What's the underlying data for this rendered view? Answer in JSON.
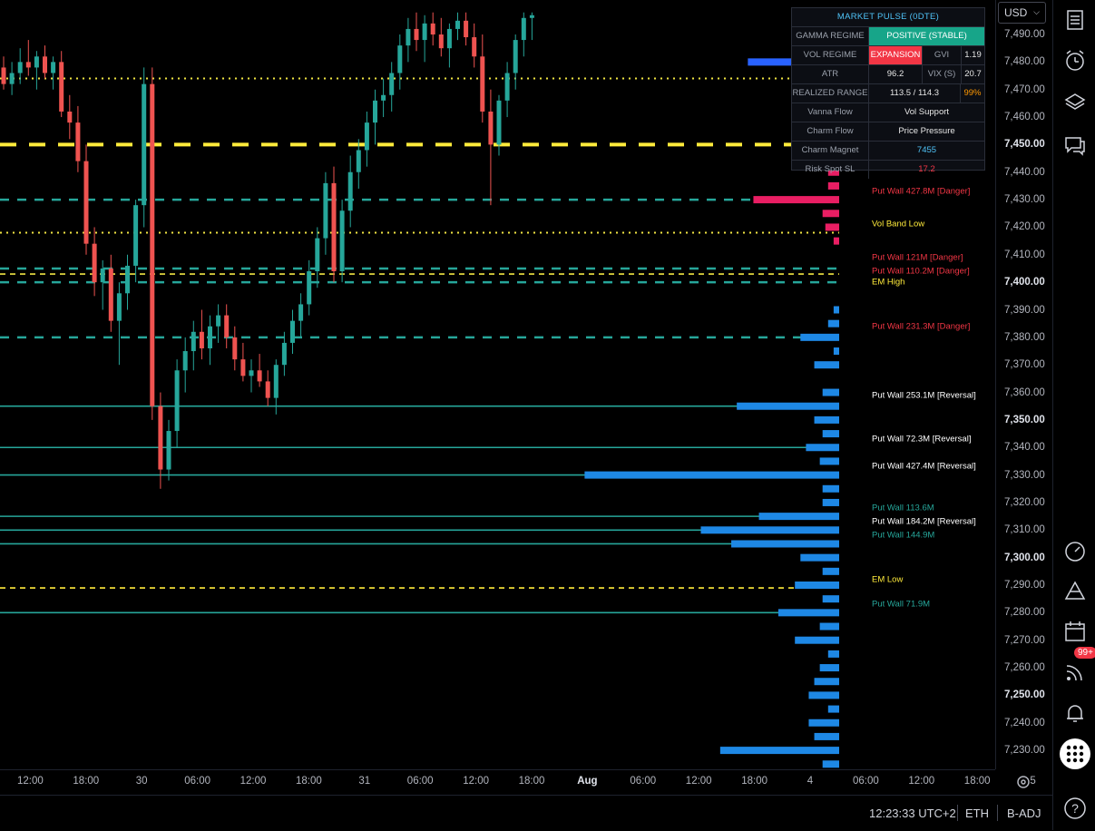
{
  "currency": {
    "label": "USD"
  },
  "price_axis": {
    "ticks": [
      {
        "label": "7,490.00",
        "v": 7490,
        "major": false
      },
      {
        "label": "7,480.00",
        "v": 7480,
        "major": false
      },
      {
        "label": "7,470.00",
        "v": 7470,
        "major": false
      },
      {
        "label": "7,460.00",
        "v": 7460,
        "major": false
      },
      {
        "label": "7,450.00",
        "v": 7450,
        "major": true
      },
      {
        "label": "7,440.00",
        "v": 7440,
        "major": false
      },
      {
        "label": "7,430.00",
        "v": 7430,
        "major": false
      },
      {
        "label": "7,420.00",
        "v": 7420,
        "major": false
      },
      {
        "label": "7,410.00",
        "v": 7410,
        "major": false
      },
      {
        "label": "7,400.00",
        "v": 7400,
        "major": true
      },
      {
        "label": "7,390.00",
        "v": 7390,
        "major": false
      },
      {
        "label": "7,380.00",
        "v": 7380,
        "major": false
      },
      {
        "label": "7,370.00",
        "v": 7370,
        "major": false
      },
      {
        "label": "7,360.00",
        "v": 7360,
        "major": false
      },
      {
        "label": "7,350.00",
        "v": 7350,
        "major": true
      },
      {
        "label": "7,340.00",
        "v": 7340,
        "major": false
      },
      {
        "label": "7,330.00",
        "v": 7330,
        "major": false
      },
      {
        "label": "7,320.00",
        "v": 7320,
        "major": false
      },
      {
        "label": "7,310.00",
        "v": 7310,
        "major": false
      },
      {
        "label": "7,300.00",
        "v": 7300,
        "major": true
      },
      {
        "label": "7,290.00",
        "v": 7290,
        "major": false
      },
      {
        "label": "7,280.00",
        "v": 7280,
        "major": false
      },
      {
        "label": "7,270.00",
        "v": 7270,
        "major": false
      },
      {
        "label": "7,260.00",
        "v": 7260,
        "major": false
      },
      {
        "label": "7,250.00",
        "v": 7250,
        "major": true
      },
      {
        "label": "7,240.00",
        "v": 7240,
        "major": false
      },
      {
        "label": "7,230.00",
        "v": 7230,
        "major": false
      }
    ]
  },
  "time_axis": {
    "ticks": [
      {
        "label": "12:00",
        "t": 1,
        "major": false
      },
      {
        "label": "18:00",
        "t": 2,
        "major": false
      },
      {
        "label": "30",
        "t": 3,
        "major": false
      },
      {
        "label": "06:00",
        "t": 4,
        "major": false
      },
      {
        "label": "12:00",
        "t": 5,
        "major": false
      },
      {
        "label": "18:00",
        "t": 6,
        "major": false
      },
      {
        "label": "31",
        "t": 7,
        "major": false
      },
      {
        "label": "06:00",
        "t": 8,
        "major": false
      },
      {
        "label": "12:00",
        "t": 9,
        "major": false
      },
      {
        "label": "18:00",
        "t": 10,
        "major": false
      },
      {
        "label": "Aug",
        "t": 11,
        "major": true
      },
      {
        "label": "06:00",
        "t": 12,
        "major": false
      },
      {
        "label": "12:00",
        "t": 13,
        "major": false
      },
      {
        "label": "18:00",
        "t": 14,
        "major": false
      },
      {
        "label": "4",
        "t": 15,
        "major": false
      },
      {
        "label": "06:00",
        "t": 16,
        "major": false
      },
      {
        "label": "12:00",
        "t": 17,
        "major": false
      },
      {
        "label": "18:00",
        "t": 18,
        "major": false
      },
      {
        "label": "5",
        "t": 19,
        "major": false
      }
    ]
  },
  "market_pulse": {
    "title": "MARKET PULSE (0DTE)",
    "gamma_regime": {
      "label": "GAMMA REGIME",
      "value": "POSITIVE (STABLE)",
      "color": "#17a589"
    },
    "vol_regime": {
      "label": "VOL REGIME",
      "value": "EXPANSION",
      "value_color": "#f23645",
      "sub_label": "GVI",
      "sub_value": "1.19"
    },
    "atr": {
      "label": "ATR",
      "value": "96.2",
      "sub_label": "VIX (S)",
      "sub_value": "20.7"
    },
    "realized_range": {
      "label": "REALIZED RANGE",
      "value": "113.5 / 114.3",
      "pct": "99%",
      "pct_color": "#ff9800"
    },
    "vanna_flow": {
      "label": "Vanna Flow",
      "value": "Vol Support"
    },
    "charm_flow": {
      "label": "Charm Flow",
      "value": "Price Pressure"
    },
    "charm_magnet": {
      "label": "Charm Magnet",
      "value": "7455",
      "color": "#4fc3f7"
    },
    "risk_spot": {
      "label": "Risk Spot SL",
      "value": "17.2",
      "color": "#f23645"
    }
  },
  "level_lines": [
    {
      "price": 7474,
      "style": "dotted",
      "color": "#f0e442"
    },
    {
      "price": 7450,
      "style": "thickdash",
      "color": "#ffeb3b"
    },
    {
      "price": 7430,
      "style": "dash",
      "color": "#26a69a"
    },
    {
      "price": 7418,
      "style": "dotted",
      "color": "#f0e442"
    },
    {
      "price": 7405,
      "style": "dash",
      "color": "#26a69a"
    },
    {
      "price": 7403,
      "style": "dash2",
      "color": "#f0e442"
    },
    {
      "price": 7400,
      "style": "dash",
      "color": "#26a69a"
    },
    {
      "price": 7380,
      "style": "dash",
      "color": "#26a69a"
    },
    {
      "price": 7355,
      "style": "solid",
      "color": "#26a69a"
    },
    {
      "price": 7340,
      "style": "solid",
      "color": "#26a69a"
    },
    {
      "price": 7330,
      "style": "solid",
      "color": "#26a69a"
    },
    {
      "price": 7315,
      "style": "solid",
      "color": "#26a69a"
    },
    {
      "price": 7310,
      "style": "solid",
      "color": "#26a69a"
    },
    {
      "price": 7305,
      "style": "solid",
      "color": "#26a69a"
    },
    {
      "price": 7289,
      "style": "dash2",
      "color": "#ffeb3b"
    },
    {
      "price": 7280,
      "style": "solid",
      "color": "#26a69a"
    }
  ],
  "wall_labels": [
    {
      "price": 7433,
      "text": "Put Wall 427.8M [Danger]",
      "color": "#f23645"
    },
    {
      "price": 7421,
      "text": "Vol Band Low",
      "color": "#ffeb3b"
    },
    {
      "price": 7409,
      "text": "Put Wall 121M [Danger]",
      "color": "#f23645"
    },
    {
      "price": 7404,
      "text": "Put Wall 110.2M [Danger]",
      "color": "#f23645"
    },
    {
      "price": 7400,
      "text": "EM High",
      "color": "#ffeb3b"
    },
    {
      "price": 7384,
      "text": "Put Wall 231.3M [Danger]",
      "color": "#f23645"
    },
    {
      "price": 7359,
      "text": "Put Wall 253.1M [Reversal]",
      "color": "#ffffff"
    },
    {
      "price": 7343,
      "text": "Put Wall 72.3M [Reversal]",
      "color": "#ffffff"
    },
    {
      "price": 7333,
      "text": "Put Wall 427.4M [Reversal]",
      "color": "#ffffff"
    },
    {
      "price": 7318,
      "text": "Put Wall 113.6M",
      "color": "#26a69a"
    },
    {
      "price": 7313,
      "text": "Put Wall 184.2M [Reversal]",
      "color": "#ffffff"
    },
    {
      "price": 7308,
      "text": "Put Wall 144.9M",
      "color": "#26a69a"
    },
    {
      "price": 7292,
      "text": "EM Low",
      "color": "#ffeb3b"
    },
    {
      "price": 7283,
      "text": "Put Wall 71.9M",
      "color": "#26a69a"
    }
  ],
  "volume_profile": [
    {
      "price": 7480,
      "value": 0.33,
      "color": "#2962ff"
    },
    {
      "price": 7440,
      "value": 0.04,
      "color": "#e91e63"
    },
    {
      "price": 7435,
      "value": 0.04,
      "color": "#e91e63"
    },
    {
      "price": 7430,
      "value": 0.31,
      "color": "#e91e63"
    },
    {
      "price": 7425,
      "value": 0.06,
      "color": "#e91e63"
    },
    {
      "price": 7420,
      "value": 0.05,
      "color": "#e91e63"
    },
    {
      "price": 7415,
      "value": 0.02,
      "color": "#e91e63"
    },
    {
      "price": 7390,
      "value": 0.02,
      "color": "#1e88e5"
    },
    {
      "price": 7385,
      "value": 0.04,
      "color": "#1e88e5"
    },
    {
      "price": 7380,
      "value": 0.14,
      "color": "#1e88e5"
    },
    {
      "price": 7375,
      "value": 0.02,
      "color": "#1e88e5"
    },
    {
      "price": 7370,
      "value": 0.09,
      "color": "#1e88e5"
    },
    {
      "price": 7360,
      "value": 0.06,
      "color": "#1e88e5"
    },
    {
      "price": 7355,
      "value": 0.37,
      "color": "#1e88e5"
    },
    {
      "price": 7350,
      "value": 0.09,
      "color": "#1e88e5"
    },
    {
      "price": 7345,
      "value": 0.06,
      "color": "#1e88e5"
    },
    {
      "price": 7340,
      "value": 0.12,
      "color": "#1e88e5"
    },
    {
      "price": 7335,
      "value": 0.07,
      "color": "#1e88e5"
    },
    {
      "price": 7330,
      "value": 0.92,
      "color": "#1e88e5"
    },
    {
      "price": 7325,
      "value": 0.06,
      "color": "#1e88e5"
    },
    {
      "price": 7320,
      "value": 0.06,
      "color": "#1e88e5"
    },
    {
      "price": 7315,
      "value": 0.29,
      "color": "#1e88e5"
    },
    {
      "price": 7310,
      "value": 0.5,
      "color": "#1e88e5"
    },
    {
      "price": 7305,
      "value": 0.39,
      "color": "#1e88e5"
    },
    {
      "price": 7300,
      "value": 0.14,
      "color": "#1e88e5"
    },
    {
      "price": 7295,
      "value": 0.06,
      "color": "#1e88e5"
    },
    {
      "price": 7290,
      "value": 0.16,
      "color": "#1e88e5"
    },
    {
      "price": 7285,
      "value": 0.06,
      "color": "#1e88e5"
    },
    {
      "price": 7280,
      "value": 0.22,
      "color": "#1e88e5"
    },
    {
      "price": 7275,
      "value": 0.07,
      "color": "#1e88e5"
    },
    {
      "price": 7270,
      "value": 0.16,
      "color": "#1e88e5"
    },
    {
      "price": 7265,
      "value": 0.04,
      "color": "#1e88e5"
    },
    {
      "price": 7260,
      "value": 0.07,
      "color": "#1e88e5"
    },
    {
      "price": 7255,
      "value": 0.09,
      "color": "#1e88e5"
    },
    {
      "price": 7250,
      "value": 0.11,
      "color": "#1e88e5"
    },
    {
      "price": 7245,
      "value": 0.04,
      "color": "#1e88e5"
    },
    {
      "price": 7240,
      "value": 0.11,
      "color": "#1e88e5"
    },
    {
      "price": 7235,
      "value": 0.09,
      "color": "#1e88e5"
    },
    {
      "price": 7230,
      "value": 0.43,
      "color": "#1e88e5"
    },
    {
      "price": 7225,
      "value": 0.06,
      "color": "#1e88e5"
    }
  ],
  "candles": {
    "up_color": "#26a69a",
    "down_color": "#ef5350",
    "ohlc": [
      [
        7478,
        7482,
        7470,
        7472
      ],
      [
        7472,
        7480,
        7468,
        7476
      ],
      [
        7476,
        7485,
        7472,
        7480
      ],
      [
        7480,
        7488,
        7475,
        7478
      ],
      [
        7478,
        7484,
        7470,
        7482
      ],
      [
        7482,
        7486,
        7474,
        7476
      ],
      [
        7476,
        7482,
        7470,
        7480
      ],
      [
        7480,
        7484,
        7460,
        7462
      ],
      [
        7462,
        7468,
        7452,
        7458
      ],
      [
        7458,
        7464,
        7440,
        7444
      ],
      [
        7444,
        7450,
        7410,
        7414
      ],
      [
        7414,
        7420,
        7395,
        7400
      ],
      [
        7400,
        7408,
        7390,
        7405
      ],
      [
        7405,
        7410,
        7382,
        7386
      ],
      [
        7386,
        7400,
        7370,
        7396
      ],
      [
        7396,
        7410,
        7390,
        7406
      ],
      [
        7406,
        7430,
        7400,
        7428
      ],
      [
        7428,
        7478,
        7420,
        7472
      ],
      [
        7472,
        7478,
        7350,
        7355
      ],
      [
        7355,
        7360,
        7325,
        7332
      ],
      [
        7332,
        7350,
        7328,
        7346
      ],
      [
        7346,
        7372,
        7340,
        7368
      ],
      [
        7368,
        7380,
        7360,
        7375
      ],
      [
        7375,
        7386,
        7368,
        7382
      ],
      [
        7382,
        7390,
        7372,
        7376
      ],
      [
        7376,
        7388,
        7370,
        7384
      ],
      [
        7384,
        7392,
        7378,
        7388
      ],
      [
        7388,
        7392,
        7376,
        7380
      ],
      [
        7380,
        7384,
        7368,
        7372
      ],
      [
        7372,
        7378,
        7364,
        7366
      ],
      [
        7366,
        7372,
        7360,
        7368
      ],
      [
        7368,
        7374,
        7362,
        7364
      ],
      [
        7364,
        7368,
        7355,
        7358
      ],
      [
        7358,
        7372,
        7352,
        7370
      ],
      [
        7370,
        7382,
        7366,
        7378
      ],
      [
        7378,
        7390,
        7374,
        7386
      ],
      [
        7386,
        7396,
        7380,
        7392
      ],
      [
        7392,
        7408,
        7388,
        7404
      ],
      [
        7404,
        7420,
        7398,
        7416
      ],
      [
        7416,
        7440,
        7410,
        7436
      ],
      [
        7436,
        7442,
        7400,
        7404
      ],
      [
        7404,
        7430,
        7400,
        7426
      ],
      [
        7426,
        7446,
        7420,
        7440
      ],
      [
        7440,
        7452,
        7434,
        7448
      ],
      [
        7448,
        7462,
        7442,
        7458
      ],
      [
        7458,
        7470,
        7450,
        7466
      ],
      [
        7466,
        7474,
        7460,
        7468
      ],
      [
        7468,
        7480,
        7462,
        7476
      ],
      [
        7476,
        7490,
        7470,
        7486
      ],
      [
        7486,
        7496,
        7480,
        7492
      ],
      [
        7492,
        7498,
        7484,
        7488
      ],
      [
        7488,
        7497,
        7480,
        7494
      ],
      [
        7494,
        7498,
        7486,
        7490
      ],
      [
        7490,
        7496,
        7482,
        7485
      ],
      [
        7485,
        7494,
        7478,
        7492
      ],
      [
        7492,
        7498,
        7488,
        7495
      ],
      [
        7495,
        7498,
        7486,
        7489
      ],
      [
        7489,
        7494,
        7478,
        7482
      ],
      [
        7482,
        7490,
        7458,
        7462
      ],
      [
        7462,
        7470,
        7428,
        7450
      ],
      [
        7450,
        7468,
        7446,
        7466
      ],
      [
        7466,
        7480,
        7460,
        7476
      ],
      [
        7476,
        7490,
        7470,
        7488
      ],
      [
        7488,
        7498,
        7482,
        7496
      ],
      [
        7496,
        7498,
        7488,
        7497
      ]
    ]
  },
  "status_bar": {
    "time": "12:23:33 UTC+2",
    "session": "ETH",
    "adjust": "B-ADJ"
  },
  "sidebar": {
    "badge": "99+"
  }
}
